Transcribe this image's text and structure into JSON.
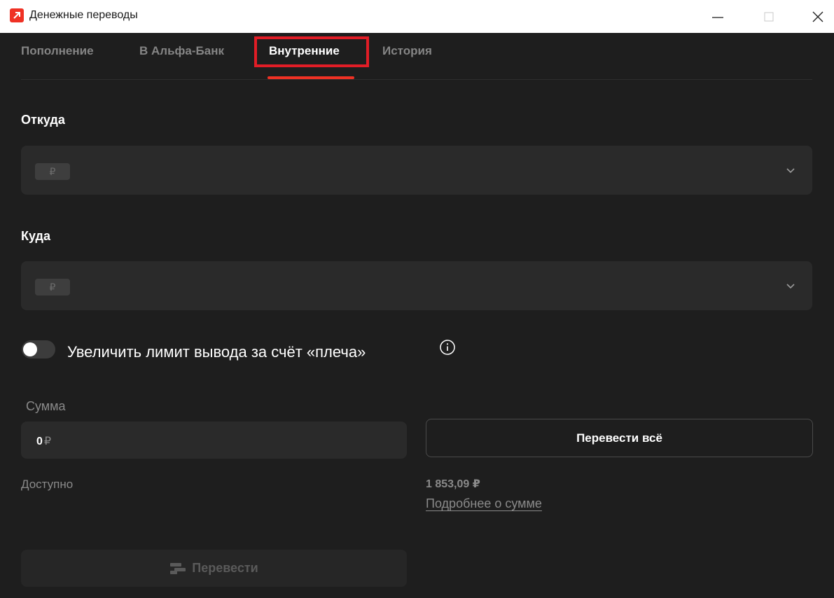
{
  "window": {
    "title": "Денежные переводы",
    "app_icon": "alfa-bank-arrow-icon"
  },
  "tabs": [
    {
      "label": "Пополнение",
      "active": false
    },
    {
      "label": "В Альфа-Банк",
      "active": false
    },
    {
      "label": "Внутренние",
      "active": true
    },
    {
      "label": "История",
      "active": false
    }
  ],
  "from": {
    "label": "Откуда",
    "currency_symbol": "₽"
  },
  "to": {
    "label": "Куда",
    "currency_symbol": "₽"
  },
  "leverage_toggle": {
    "label": "Увеличить лимит вывода за счёт «плеча»",
    "enabled": false
  },
  "amount": {
    "label": "Сумма",
    "value": "0",
    "currency": "₽"
  },
  "transfer_all_label": "Перевести всё",
  "available": {
    "label": "Доступно",
    "value": "1 853,09 ₽",
    "details_link": "Подробнее о сумме"
  },
  "transfer_button_label": "Перевести",
  "colors": {
    "background": "#1e1e1e",
    "accent": "#ef3124",
    "field": "#2a2a2a"
  }
}
